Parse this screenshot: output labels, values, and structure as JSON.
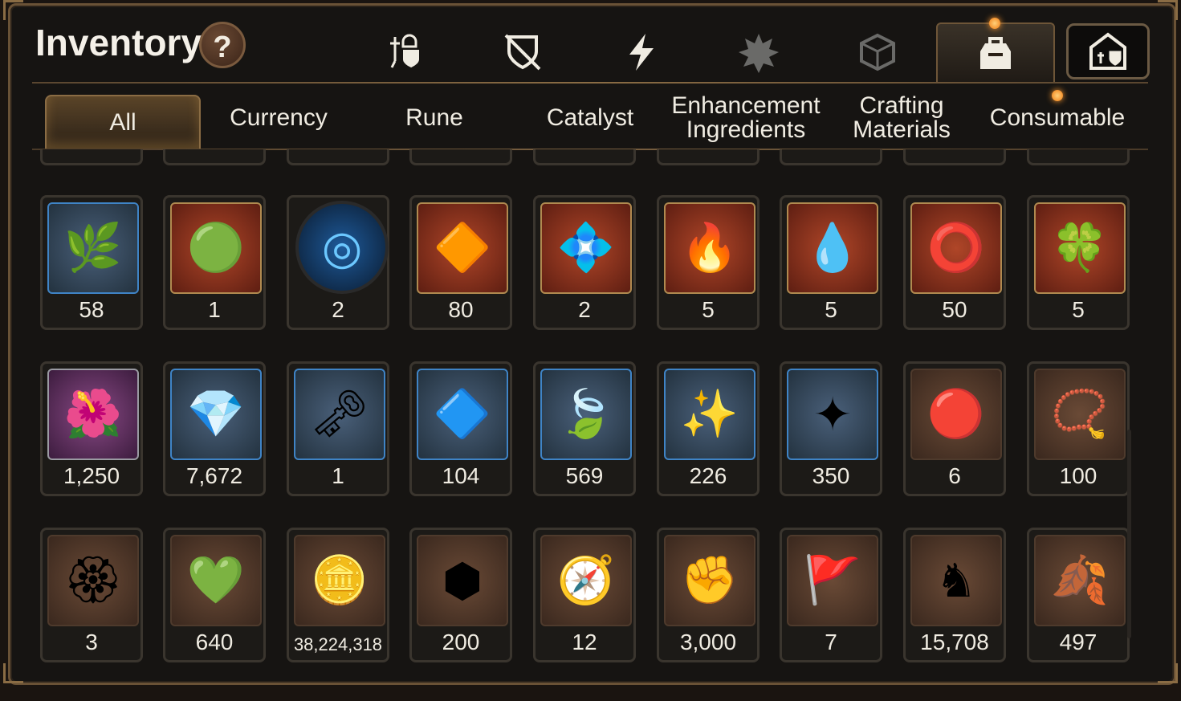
{
  "title": "Inventory",
  "help_label": "?",
  "top_tabs": [
    {
      "icon": "gear-equipment-icon"
    },
    {
      "icon": "broken-shield-icon"
    },
    {
      "icon": "lightning-icon"
    },
    {
      "icon": "burst-icon"
    },
    {
      "icon": "cube-icon"
    },
    {
      "icon": "backpack-icon",
      "active": true
    },
    {
      "icon": "guild-hall-icon"
    }
  ],
  "sub_tabs": [
    {
      "label": "All",
      "active": true
    },
    {
      "label": "Currency"
    },
    {
      "label": "Rune"
    },
    {
      "label": "Catalyst"
    },
    {
      "label": "Enhancement Ingredients"
    },
    {
      "label": "Crafting Materials"
    },
    {
      "label": "Consumable"
    }
  ],
  "rows": [
    [
      {
        "icon": "ginseng-root-icon",
        "glyph": "🌿",
        "frame": "blue",
        "qty": "58"
      },
      {
        "icon": "green-orb-icon",
        "glyph": "🟢",
        "frame": "red",
        "qty": "1"
      },
      {
        "icon": "blue-rune-disc-icon",
        "glyph": "◎",
        "frame": "round",
        "qty": "2"
      },
      {
        "icon": "orange-crystal-icon",
        "glyph": "🔶",
        "frame": "red",
        "qty": "80"
      },
      {
        "icon": "triquetra-crystal-icon",
        "glyph": "💠",
        "frame": "red",
        "qty": "2"
      },
      {
        "icon": "fire-pendant-icon",
        "glyph": "🔥",
        "frame": "red",
        "qty": "5"
      },
      {
        "icon": "water-pendant-icon",
        "glyph": "💧",
        "frame": "red",
        "qty": "5"
      },
      {
        "icon": "dark-ring-pendant-icon",
        "glyph": "⭕",
        "frame": "red",
        "qty": "50"
      },
      {
        "icon": "clover-pendant-icon",
        "glyph": "🍀",
        "frame": "red",
        "qty": "5"
      }
    ],
    [
      {
        "icon": "flower-ring-icon",
        "glyph": "🌺",
        "frame": "purple",
        "qty": "1,250"
      },
      {
        "icon": "blue-gem-icon",
        "glyph": "💎",
        "frame": "blue",
        "qty": "7,672"
      },
      {
        "icon": "pocket-watch-icon",
        "glyph": "🗝",
        "frame": "blue",
        "qty": "1"
      },
      {
        "icon": "teal-crystal-icon",
        "glyph": "🔷",
        "frame": "blue",
        "qty": "104"
      },
      {
        "icon": "green-leaf-icon",
        "glyph": "🍃",
        "frame": "blue",
        "qty": "569"
      },
      {
        "icon": "pink-crystal-cluster-icon",
        "glyph": "✨",
        "frame": "blue",
        "qty": "226"
      },
      {
        "icon": "star-pendant-icon",
        "glyph": "✦",
        "frame": "blue",
        "qty": "350"
      },
      {
        "icon": "red-energy-orb-icon",
        "glyph": "🔴",
        "frame": "brown",
        "qty": "6"
      },
      {
        "icon": "red-bracelet-icon",
        "glyph": "📿",
        "frame": "brown",
        "qty": "100"
      }
    ],
    [
      {
        "icon": "red-badge-icon",
        "glyph": "🏵",
        "frame": "brown",
        "qty": "3"
      },
      {
        "icon": "green-heart-icon",
        "glyph": "💚",
        "frame": "brown",
        "qty": "640"
      },
      {
        "icon": "gold-coin-icon",
        "glyph": "🪙",
        "frame": "brown",
        "qty": "38,224,318",
        "small": true
      },
      {
        "icon": "gold-hexagon-emblem-icon",
        "glyph": "⬢",
        "frame": "brown",
        "qty": "200"
      },
      {
        "icon": "stone-compass-icon",
        "glyph": "🧭",
        "frame": "brown",
        "qty": "12"
      },
      {
        "icon": "fist-emblem-icon",
        "glyph": "✊",
        "frame": "brown",
        "qty": "3,000"
      },
      {
        "icon": "war-banner-icon",
        "glyph": "🚩",
        "frame": "brown",
        "qty": "7"
      },
      {
        "icon": "knight-chess-piece-icon",
        "glyph": "♞",
        "frame": "brown",
        "qty": "15,708"
      },
      {
        "icon": "red-leaf-icon",
        "glyph": "🍂",
        "frame": "brown",
        "qty": "497"
      }
    ]
  ]
}
